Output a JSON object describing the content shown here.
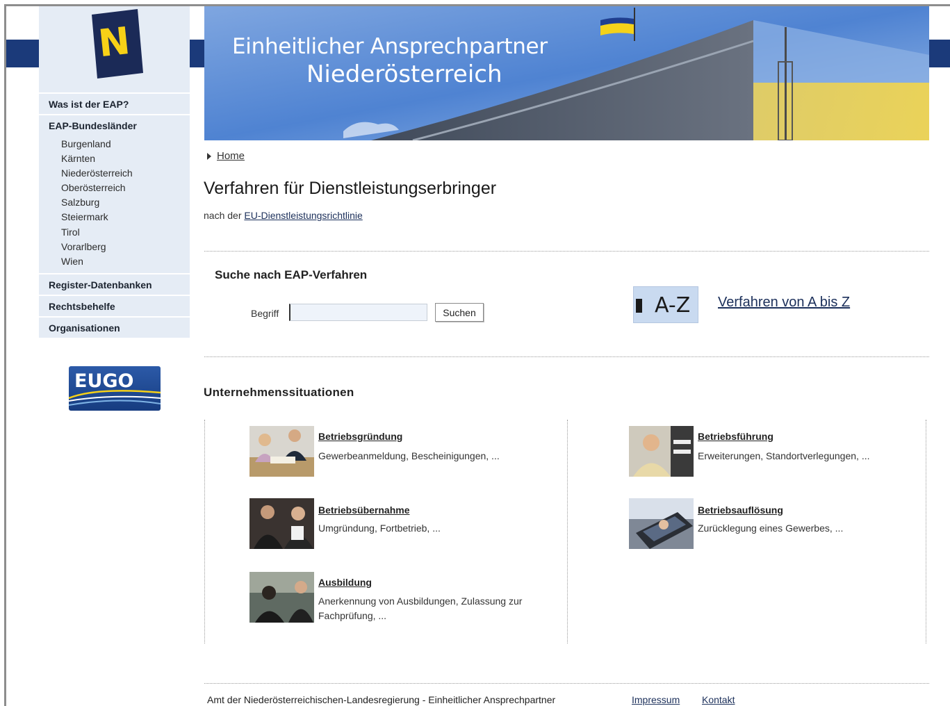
{
  "sidebar": {
    "nav": [
      {
        "label": "Was ist der EAP?"
      },
      {
        "label": "EAP-Bundesländer"
      }
    ],
    "states": [
      "Burgenland",
      "Kärnten",
      "Niederösterreich",
      "Oberösterreich",
      "Salzburg",
      "Steiermark",
      "Tirol",
      "Vorarlberg",
      "Wien"
    ],
    "nav2": [
      {
        "label": "Register-Datenbanken"
      },
      {
        "label": "Rechtsbehelfe"
      },
      {
        "label": "Organisationen"
      }
    ],
    "logo_text": "N",
    "eugo_text": "EUGO"
  },
  "banner": {
    "line1": "Einheitlicher Ansprechpartner",
    "line2": "Niederösterreich"
  },
  "breadcrumb": {
    "home": "Home"
  },
  "page": {
    "title": "Verfahren für Dienstleistungserbringer",
    "subline_prefix": "nach der",
    "subline_link": "EU-Dienstleistungsrichtlinie"
  },
  "search": {
    "title": "Suche nach EAP-Verfahren",
    "label": "Begriff",
    "value": "",
    "button": "Suchen"
  },
  "az": {
    "icon_text": "A-Z",
    "link": "Verfahren von A bis Z"
  },
  "situations": {
    "title": "Unternehmenssituationen",
    "items": [
      {
        "title": "Betriebsgründung",
        "desc": "Gewerbeanmeldung, Bescheinigungen, ..."
      },
      {
        "title": "Betriebsführung",
        "desc": "Erweiterungen, Standortverlegungen, ..."
      },
      {
        "title": "Betriebsübernahme",
        "desc": "Umgründung, Fortbetrieb, ..."
      },
      {
        "title": "Betriebsauflösung",
        "desc": "Zurücklegung eines Gewerbes, ..."
      },
      {
        "title": "Ausbildung",
        "desc": "Anerkennung von Ausbildungen, Zulassung zur Fachprüfung, ..."
      }
    ]
  },
  "footer": {
    "text": "Amt der Niederösterreichischen-Landesregierung - Einheitlicher Ansprechpartner",
    "impressum": "Impressum",
    "kontakt": "Kontakt"
  },
  "colors": {
    "accent_blue": "#1b3a7a",
    "logo_yellow": "#f7d117",
    "sidebar_bg": "#e5ecf5"
  }
}
